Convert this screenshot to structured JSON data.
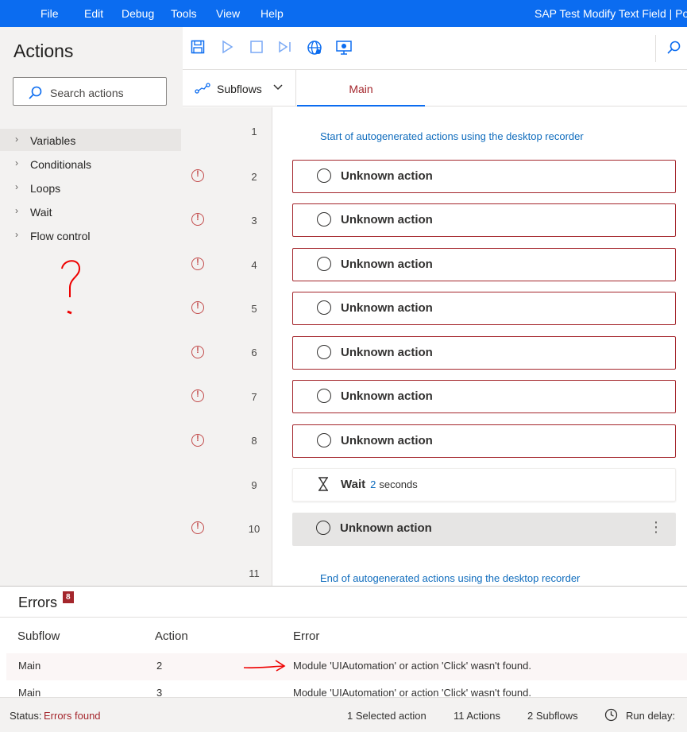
{
  "menu": {
    "items": [
      "File",
      "Edit",
      "Debug",
      "Tools",
      "View",
      "Help"
    ],
    "window_title": "SAP Test Modify Text Field | Pow"
  },
  "sidebar": {
    "title": "Actions",
    "search_placeholder": "Search actions",
    "categories": [
      "Variables",
      "Conditionals",
      "Loops",
      "Wait",
      "Flow control"
    ],
    "annotation": "?"
  },
  "toolbar": {
    "icons": [
      "save-icon",
      "run-icon",
      "stop-icon",
      "step-icon",
      "web-recorder-icon",
      "desktop-recorder-icon",
      "search-icon"
    ]
  },
  "tabs": {
    "subflows_label": "Subflows",
    "main_label": "Main"
  },
  "flow": {
    "lines": [
      "1",
      "2",
      "3",
      "4",
      "5",
      "6",
      "7",
      "8",
      "9",
      "10",
      "11"
    ],
    "start_comment": "Start of autogenerated actions using the desktop recorder",
    "end_comment": "End of autogenerated actions using the desktop recorder",
    "actions": [
      {
        "line": "2",
        "name": "Unknown action"
      },
      {
        "line": "3",
        "name": "Unknown action"
      },
      {
        "line": "4",
        "name": "Unknown action"
      },
      {
        "line": "5",
        "name": "Unknown action"
      },
      {
        "line": "6",
        "name": "Unknown action"
      },
      {
        "line": "7",
        "name": "Unknown action"
      },
      {
        "line": "8",
        "name": "Unknown action"
      },
      {
        "line": "10",
        "name": "Unknown action"
      }
    ],
    "wait": {
      "name": "Wait",
      "value": "2",
      "unit": "seconds"
    }
  },
  "errors": {
    "title": "Errors",
    "count": "8",
    "columns": [
      "Subflow",
      "Action",
      "Error"
    ],
    "rows": [
      {
        "subflow": "Main",
        "action": "2",
        "error": "Module 'UIAutomation' or action 'Click' wasn't found."
      },
      {
        "subflow": "Main",
        "action": "3",
        "error": "Module 'UIAutomation' or action 'Click' wasn't found."
      }
    ]
  },
  "status": {
    "label": "Status:",
    "value": "Errors found",
    "selected": "1 Selected action",
    "actions": "11 Actions",
    "subflows": "2 Subflows",
    "run_delay": "Run delay:"
  },
  "colors": {
    "accent": "#0b6cf0",
    "error": "#a4262c"
  }
}
